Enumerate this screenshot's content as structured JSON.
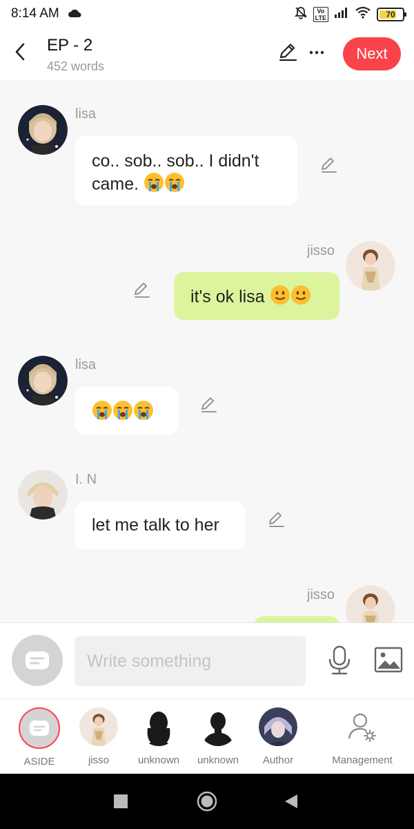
{
  "status_bar": {
    "time": "8:14 AM",
    "network_badge": "Vo\nLTE",
    "battery_level": "70",
    "battery_color": "#f5d547",
    "icons": [
      "cloud-icon",
      "bell-off-icon",
      "volte-icon",
      "signal-icon",
      "wifi-icon",
      "battery-icon"
    ]
  },
  "header": {
    "title": "EP - 2",
    "word_count": "452 words",
    "next_label": "Next",
    "accent_color": "#f9434b"
  },
  "messages": [
    {
      "sender": "lisa",
      "side": "left",
      "text": "co.. sob.. sob.. I didn't came.",
      "emojis": [
        "loudly-crying-face",
        "loudly-crying-face"
      ],
      "avatar": "lisa-avatar"
    },
    {
      "sender": "jisso",
      "side": "right",
      "text": "it's ok lisa",
      "emojis": [
        "slightly-smiling-face",
        "slightly-smiling-face"
      ],
      "avatar": "jisso-avatar"
    },
    {
      "sender": "lisa",
      "side": "left",
      "text": "",
      "emojis": [
        "loudly-crying-face",
        "loudly-crying-face",
        "loudly-crying-face"
      ],
      "avatar": "lisa-avatar"
    },
    {
      "sender": "I. N",
      "side": "left",
      "text": "let me talk to her",
      "emojis": [],
      "avatar": "in-avatar"
    },
    {
      "sender": "jisso",
      "side": "right",
      "text": "",
      "emojis": [],
      "avatar": "jisso-avatar"
    }
  ],
  "input": {
    "placeholder": "Write something",
    "value": ""
  },
  "characters": [
    {
      "label": "ASIDE",
      "selected": true
    },
    {
      "label": "jisso",
      "selected": false
    },
    {
      "label": "unknown",
      "selected": false
    },
    {
      "label": "unknown",
      "selected": false
    },
    {
      "label": "Author",
      "selected": false
    },
    {
      "label": "Management",
      "selected": false
    }
  ],
  "colors": {
    "right_bubble": "#dcf59c",
    "left_bubble": "#ffffff",
    "background": "#f7f7f7"
  }
}
